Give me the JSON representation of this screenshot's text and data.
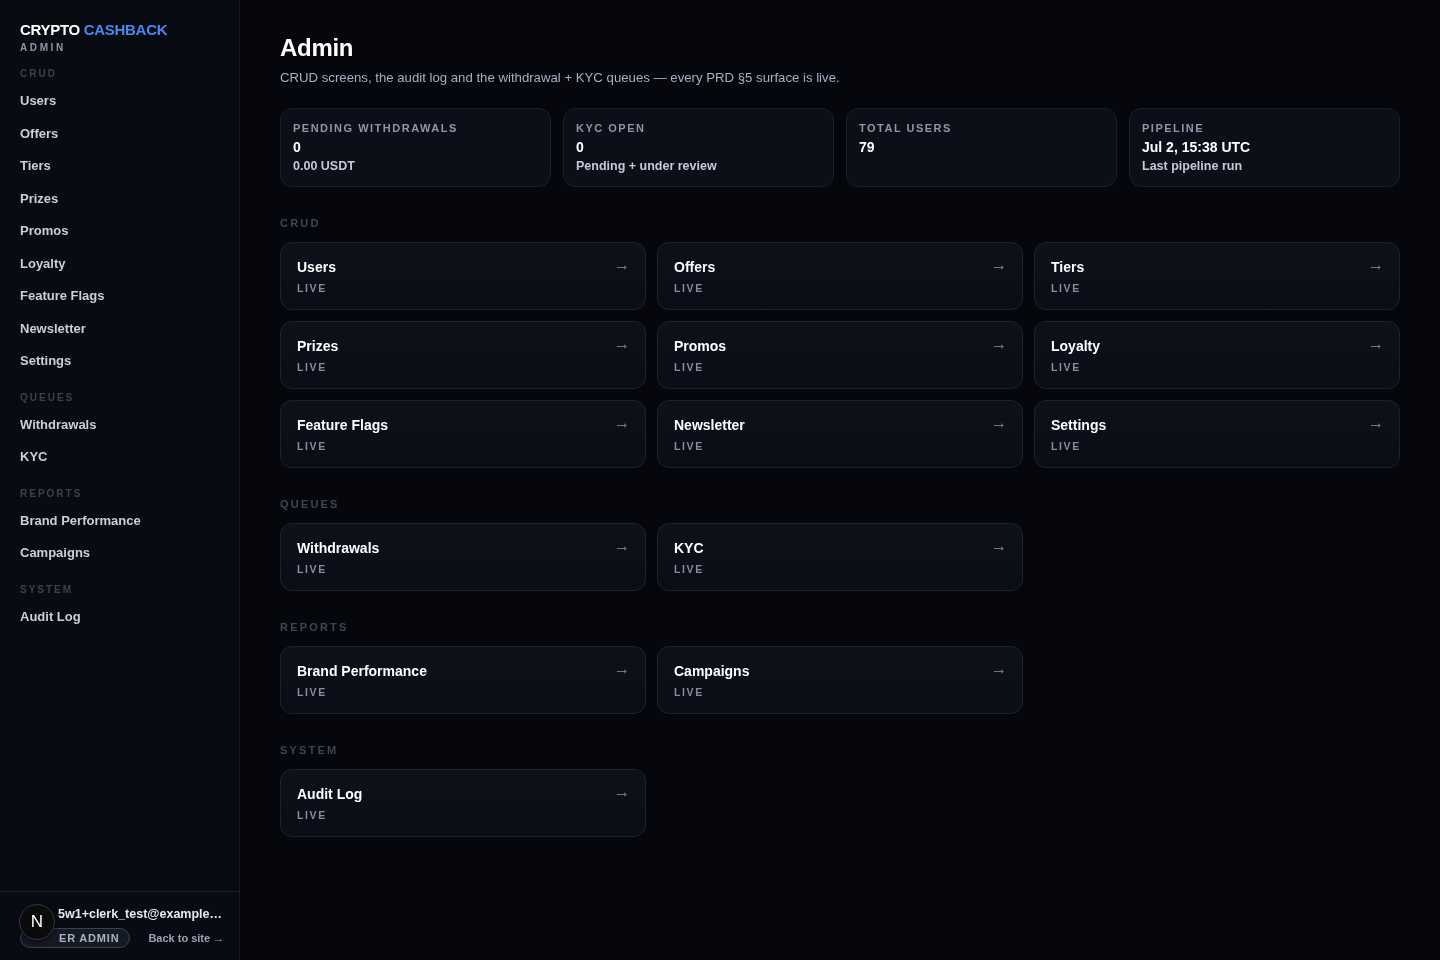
{
  "sidebar": {
    "brand": {
      "first": "CRYPTO",
      "second": "CASHBACK"
    },
    "subtitle": "ADMIN",
    "sections": [
      {
        "label": "CRUD",
        "items": [
          {
            "label": "Users"
          },
          {
            "label": "Offers"
          },
          {
            "label": "Tiers"
          },
          {
            "label": "Prizes"
          },
          {
            "label": "Promos"
          },
          {
            "label": "Loyalty"
          },
          {
            "label": "Feature Flags"
          },
          {
            "label": "Newsletter"
          },
          {
            "label": "Settings"
          }
        ]
      },
      {
        "label": "QUEUES",
        "items": [
          {
            "label": "Withdrawals"
          },
          {
            "label": "KYC"
          }
        ]
      },
      {
        "label": "REPORTS",
        "items": [
          {
            "label": "Brand Performance"
          },
          {
            "label": "Campaigns"
          }
        ]
      },
      {
        "label": "SYSTEM",
        "items": [
          {
            "label": "Audit Log"
          }
        ]
      }
    ],
    "footer": {
      "email": "5w1+clerk_test@example…",
      "role_badge": "ER ADMIN",
      "back_link": "Back to site →"
    },
    "dev_indicator": "N"
  },
  "page": {
    "title": "Admin",
    "description": "CRUD screens, the audit log and the withdrawal + KYC queues — every PRD §5 surface is live.",
    "stats": [
      {
        "label": "PENDING WITHDRAWALS",
        "value": "0",
        "note": "0.00 USDT"
      },
      {
        "label": "KYC OPEN",
        "value": "0",
        "note": "Pending + under review"
      },
      {
        "label": "TOTAL USERS",
        "value": "79"
      },
      {
        "label": "PIPELINE",
        "value": "Jul 2, 15:38 UTC",
        "note": "Last pipeline run"
      }
    ],
    "sections": [
      {
        "label": "CRUD",
        "cards": [
          {
            "title": "Users",
            "status": "LIVE"
          },
          {
            "title": "Offers",
            "status": "LIVE"
          },
          {
            "title": "Tiers",
            "status": "LIVE"
          },
          {
            "title": "Prizes",
            "status": "LIVE"
          },
          {
            "title": "Promos",
            "status": "LIVE"
          },
          {
            "title": "Loyalty",
            "status": "LIVE"
          },
          {
            "title": "Feature Flags",
            "status": "LIVE"
          },
          {
            "title": "Newsletter",
            "status": "LIVE"
          },
          {
            "title": "Settings",
            "status": "LIVE"
          }
        ]
      },
      {
        "label": "QUEUES",
        "cards": [
          {
            "title": "Withdrawals",
            "status": "LIVE"
          },
          {
            "title": "KYC",
            "status": "LIVE"
          }
        ]
      },
      {
        "label": "REPORTS",
        "cards": [
          {
            "title": "Brand Performance",
            "status": "LIVE"
          },
          {
            "title": "Campaigns",
            "status": "LIVE"
          }
        ]
      },
      {
        "label": "SYSTEM",
        "cards": [
          {
            "title": "Audit Log",
            "status": "LIVE"
          }
        ]
      }
    ]
  }
}
